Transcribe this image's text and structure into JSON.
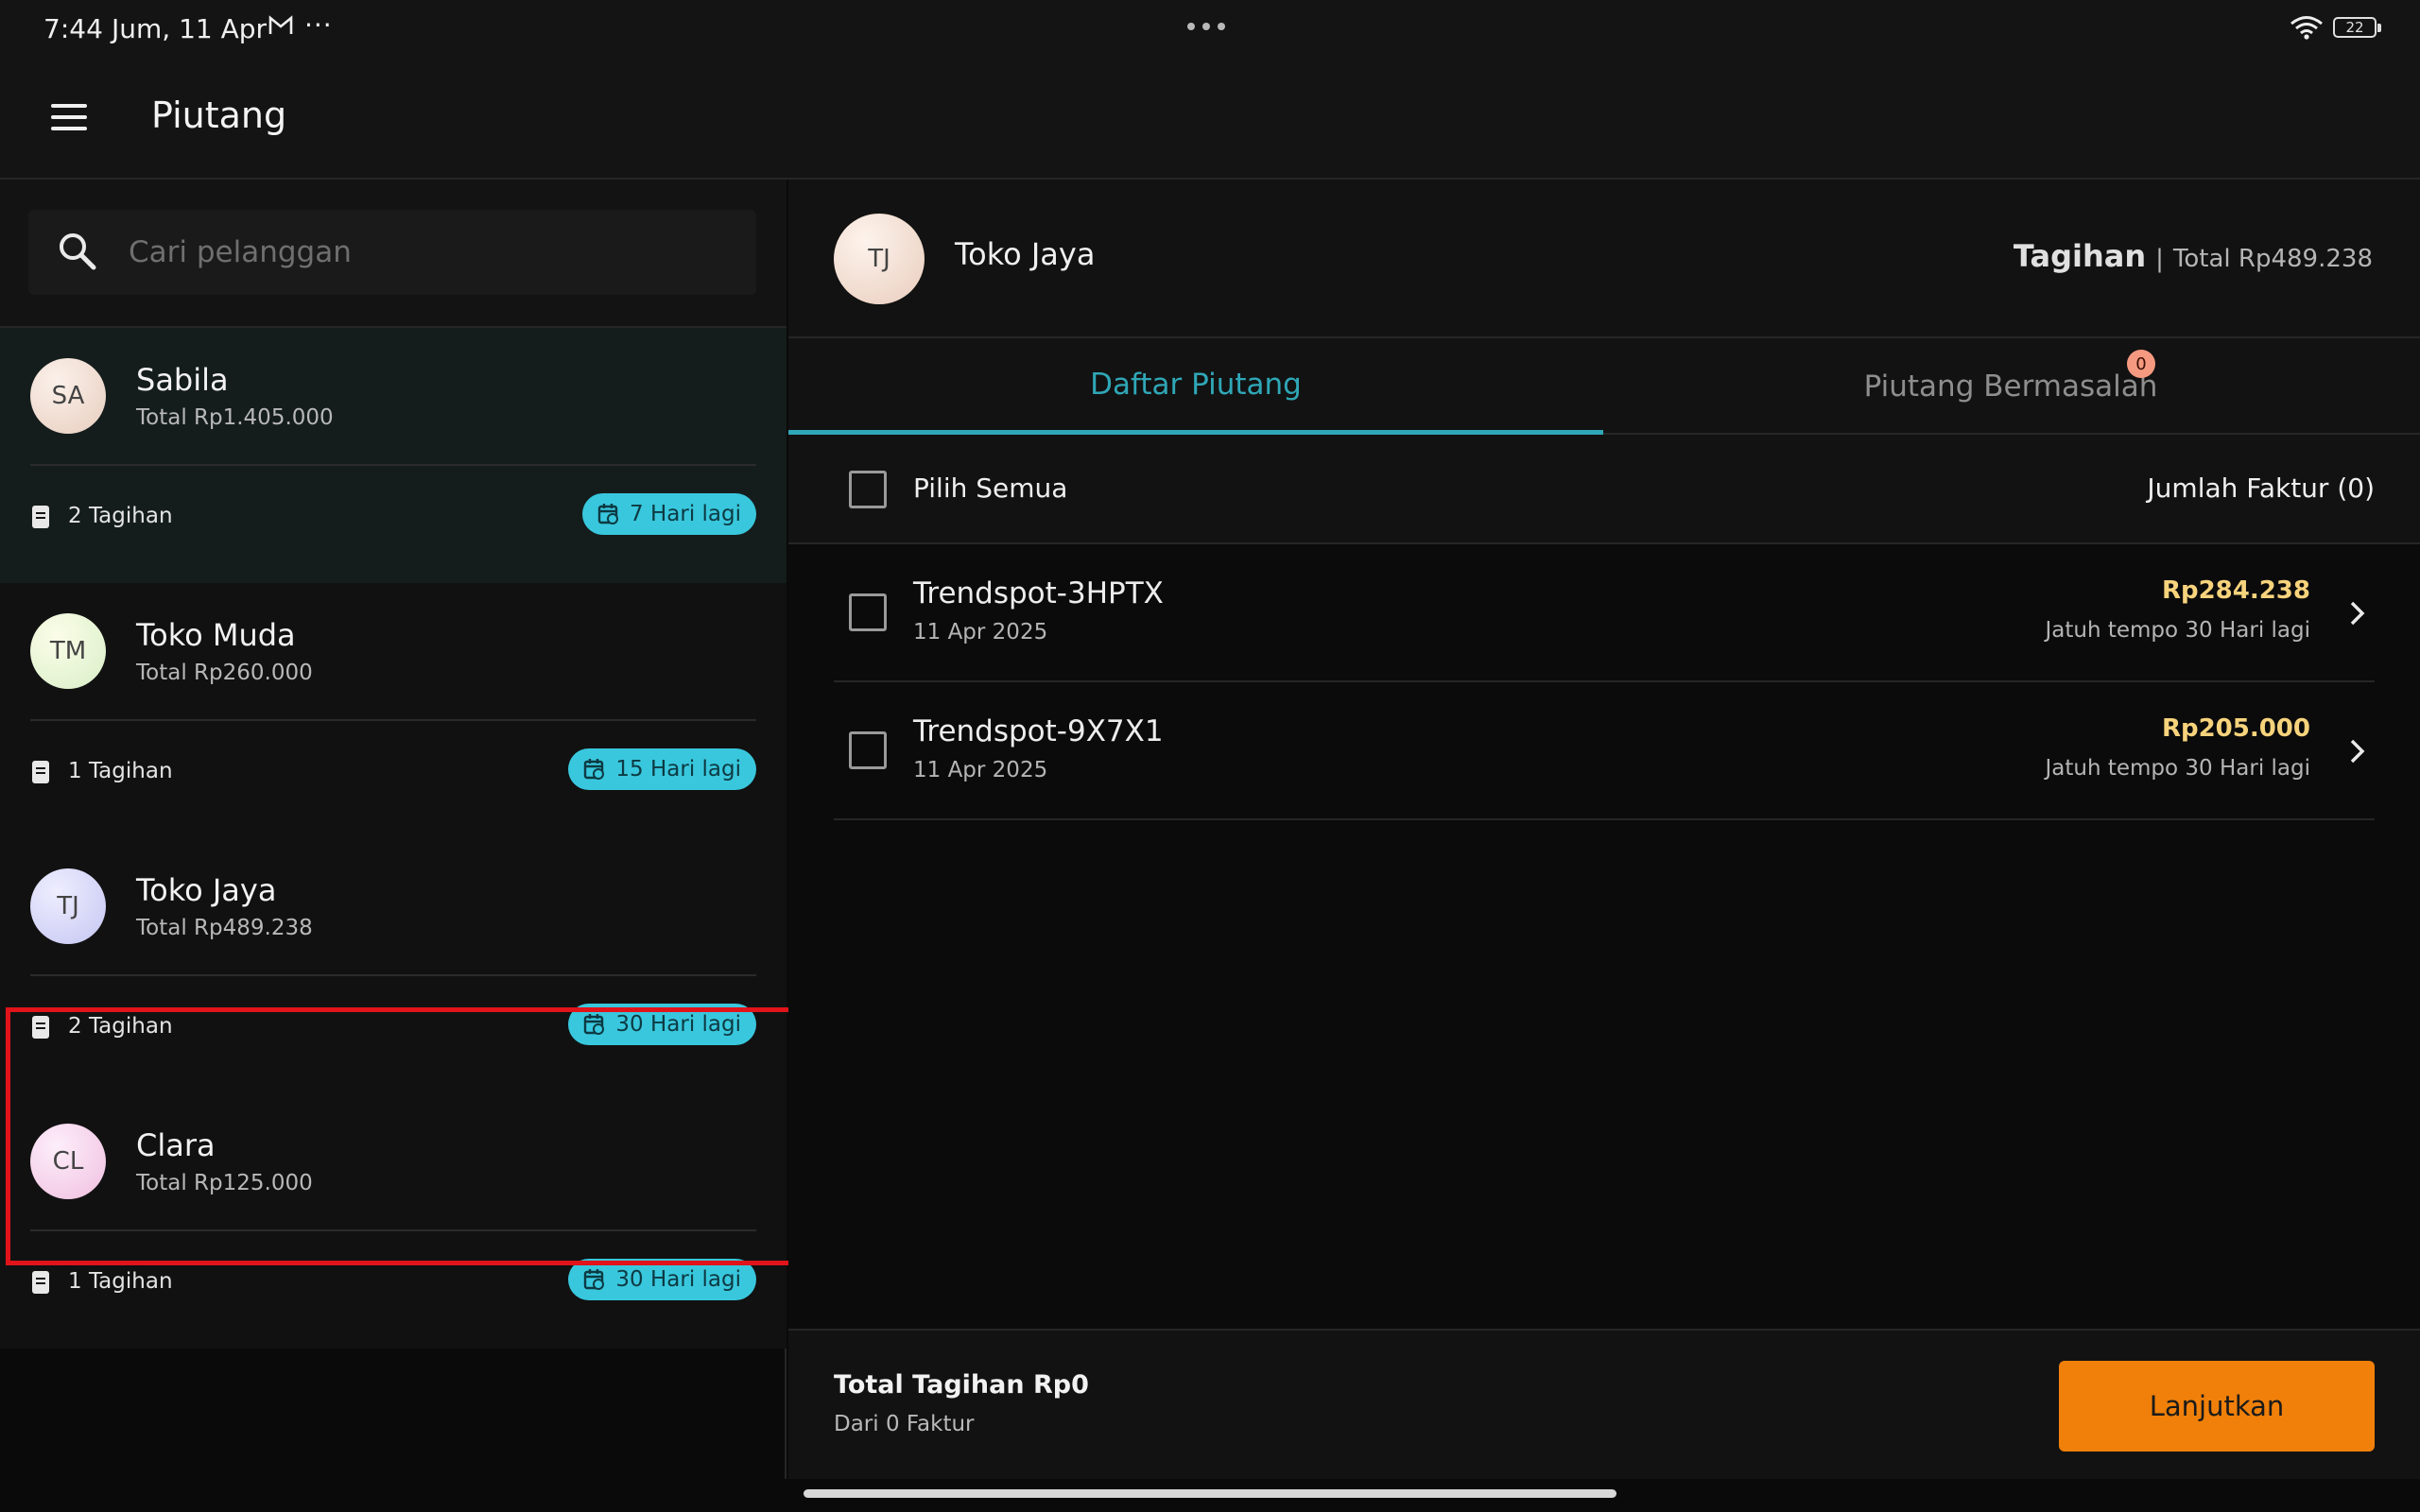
{
  "status_bar": {
    "time": "7:44",
    "date": "Jum, 11 Apr",
    "more": "···",
    "battery": "22",
    "mail_icon": "gmail-icon",
    "wifi_icon": "wifi-icon"
  },
  "app_bar": {
    "title": "Piutang",
    "menu_icon": "hamburger-menu-icon"
  },
  "search": {
    "placeholder": "Cari pelanggan",
    "value": ""
  },
  "customers": [
    {
      "initials": "SA",
      "name": "Sabila",
      "total": "Total Rp1.405.000",
      "bills": "2 Tagihan",
      "due": "7 Hari lagi",
      "selected": true
    },
    {
      "initials": "TM",
      "name": "Toko Muda",
      "total": "Total Rp260.000",
      "bills": "1 Tagihan",
      "due": "15 Hari lagi",
      "selected": false
    },
    {
      "initials": "TJ",
      "name": "Toko Jaya",
      "total": "Total Rp489.238",
      "bills": "2 Tagihan",
      "due": "30 Hari lagi",
      "selected": false
    },
    {
      "initials": "CL",
      "name": "Clara",
      "total": "Total Rp125.000",
      "bills": "1 Tagihan",
      "due": "30 Hari lagi",
      "selected": false
    }
  ],
  "detail": {
    "initials": "TJ",
    "name": "Toko Jaya",
    "tagihan_label": "Tagihan",
    "separator": "|",
    "total": "Total Rp489.238",
    "tabs": [
      {
        "label": "Daftar Piutang",
        "active": true
      },
      {
        "label": "Piutang Bermasalah",
        "active": false,
        "badge": "0"
      }
    ],
    "select_all_label": "Pilih Semua",
    "invoice_count": "Jumlah Faktur (0)",
    "invoices": [
      {
        "title": "Trendspot-3HPTX",
        "date": "11 Apr 2025",
        "amount": "Rp284.238",
        "due": "Jatuh tempo 30 Hari lagi"
      },
      {
        "title": "Trendspot-9X7X1",
        "date": "11 Apr 2025",
        "amount": "Rp205.000",
        "due": "Jatuh tempo 30 Hari lagi"
      }
    ],
    "footer": {
      "total": "Total Tagihan Rp0",
      "sub": "Dari 0 Faktur",
      "button": "Lanjutkan"
    }
  },
  "colors": {
    "accent": "#2fa7b7",
    "badge": "#39c7dd",
    "amount": "#f7d37c",
    "primary_button": "#f0800a",
    "highlight": "#e0141a"
  }
}
